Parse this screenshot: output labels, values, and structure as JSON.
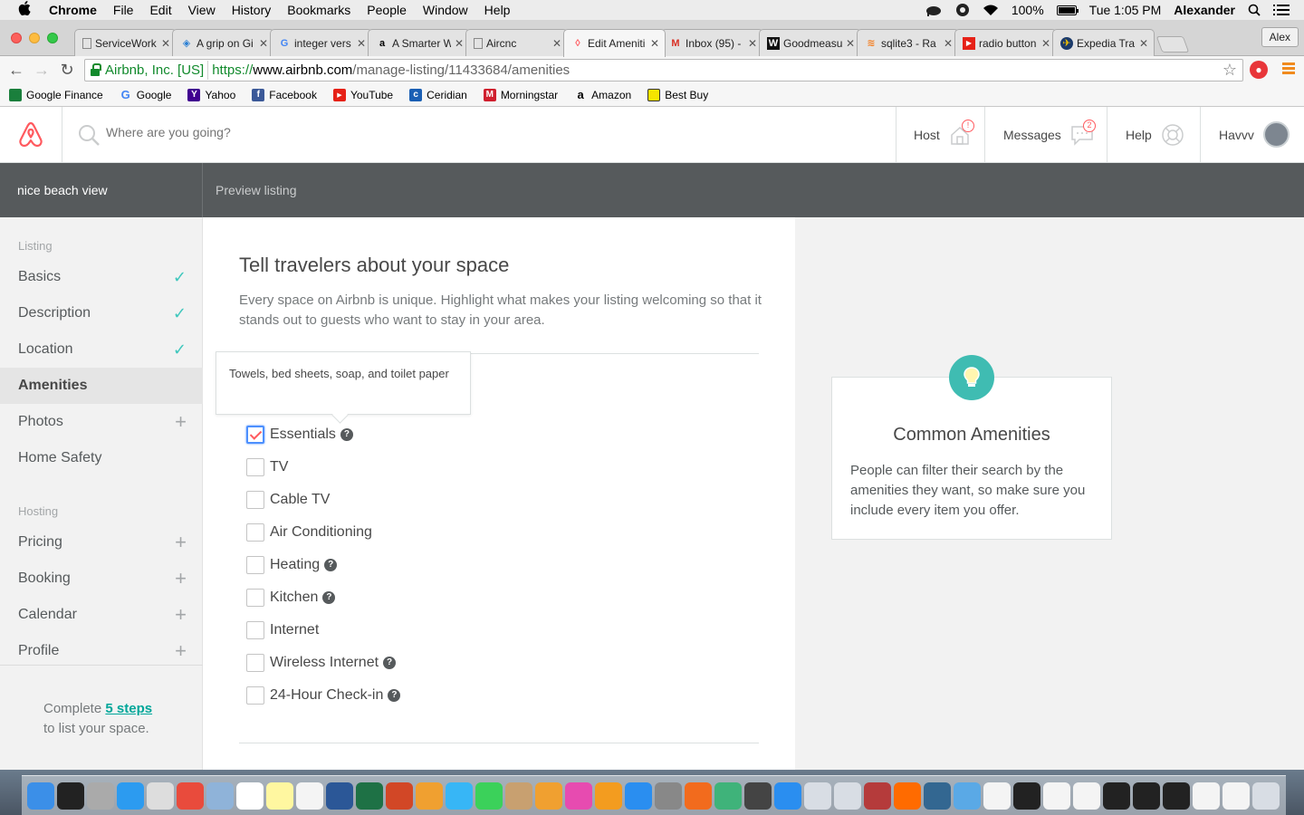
{
  "menubar": {
    "app": "Chrome",
    "items": [
      "File",
      "Edit",
      "View",
      "History",
      "Bookmarks",
      "People",
      "Window",
      "Help"
    ],
    "battery": "100%",
    "clock": "Tue 1:05 PM",
    "user": "Alexander"
  },
  "tabs": [
    {
      "title": "ServiceWork",
      "icon": "document-icon"
    },
    {
      "title": "A grip on Gi",
      "icon": "diamond-icon"
    },
    {
      "title": "integer vers",
      "icon": "google-icon"
    },
    {
      "title": "A Smarter W",
      "icon": "amazon-icon"
    },
    {
      "title": "Aircnc",
      "icon": "document-icon"
    },
    {
      "title": "Edit Ameniti",
      "icon": "airbnb-icon"
    },
    {
      "title": "Inbox (95) -",
      "icon": "gmail-icon"
    },
    {
      "title": "Goodmeasu",
      "icon": "w-icon"
    },
    {
      "title": "sqlite3 - Ra",
      "icon": "stack-icon"
    },
    {
      "title": "radio button",
      "icon": "youtube-icon"
    },
    {
      "title": "Expedia Tra",
      "icon": "globe-icon"
    }
  ],
  "profile_badge": "Alex",
  "address": {
    "ev_label": "Airbnb, Inc. [US]",
    "scheme": "https://",
    "host": "www.airbnb.com",
    "path": "/manage-listing/11433684/amenities"
  },
  "bookmarks": [
    {
      "label": "Google Finance",
      "color": "#1a7f3c"
    },
    {
      "label": "Google",
      "color": "#4285f4"
    },
    {
      "label": "Yahoo",
      "color": "#400090"
    },
    {
      "label": "Facebook",
      "color": "#3b5998"
    },
    {
      "label": "YouTube",
      "color": "#e62117"
    },
    {
      "label": "Ceridian",
      "color": "#1a5fb4"
    },
    {
      "label": "Morningstar",
      "color": "#d01f2e"
    },
    {
      "label": "Amazon",
      "color": "#222222"
    },
    {
      "label": "Best Buy",
      "color": "#f5e400"
    }
  ],
  "header": {
    "search_placeholder": "Where are you going?",
    "host_label": "Host",
    "host_badge": "!",
    "messages_label": "Messages",
    "messages_badge": "2",
    "help_label": "Help",
    "user_name": "Havvv"
  },
  "subnav": {
    "listing_name": "nice beach view",
    "preview": "Preview listing"
  },
  "sidebar": {
    "listing_section": "Listing",
    "listing_items": [
      {
        "label": "Basics",
        "state": "done"
      },
      {
        "label": "Description",
        "state": "done"
      },
      {
        "label": "Location",
        "state": "done"
      },
      {
        "label": "Amenities",
        "state": "active"
      },
      {
        "label": "Photos",
        "state": "add"
      },
      {
        "label": "Home Safety",
        "state": "none"
      }
    ],
    "hosting_section": "Hosting",
    "hosting_items": [
      {
        "label": "Pricing",
        "state": "add"
      },
      {
        "label": "Booking",
        "state": "add"
      },
      {
        "label": "Calendar",
        "state": "add"
      },
      {
        "label": "Profile",
        "state": "add"
      }
    ],
    "complete_prefix": "Complete ",
    "complete_link": "5 steps",
    "complete_suffix": "to list your space."
  },
  "main": {
    "title": "Tell travelers about your space",
    "subtitle": "Every space on Airbnb is unique. Highlight what makes your listing welcoming so that it stands out to guests who want to stay in your area.",
    "tooltip": "Towels, bed sheets, soap, and toilet paper",
    "amenities": [
      {
        "label": "Essentials",
        "checked": true,
        "help": true
      },
      {
        "label": "TV",
        "checked": false,
        "help": false
      },
      {
        "label": "Cable TV",
        "checked": false,
        "help": false
      },
      {
        "label": "Air Conditioning",
        "checked": false,
        "help": false
      },
      {
        "label": "Heating",
        "checked": false,
        "help": true
      },
      {
        "label": "Kitchen",
        "checked": false,
        "help": true
      },
      {
        "label": "Internet",
        "checked": false,
        "help": false
      },
      {
        "label": "Wireless Internet",
        "checked": false,
        "help": true
      },
      {
        "label": "24-Hour Check-in",
        "checked": false,
        "help": true
      }
    ]
  },
  "tip": {
    "title": "Common Amenities",
    "body": "People can filter their search by the amenities they want, so make sure you include every item you offer."
  },
  "colors": {
    "brand": "#ff5a5f",
    "teal": "#00a699",
    "check": "#3fc7bd"
  },
  "dock_apps": [
    "finder",
    "terminal",
    "launchpad",
    "safari",
    "grid",
    "chrome",
    "preview",
    "calendar",
    "notes",
    "textedit",
    "word",
    "excel",
    "powerpoint",
    "photos",
    "messages",
    "facetime",
    "contacts",
    "photos",
    "itunes",
    "ibooks",
    "app-store",
    "system-preferences",
    "zwift",
    "atom",
    "sublime",
    "xcode",
    "help",
    "help",
    "dictionary",
    "sublime-s",
    "postgres",
    "folder",
    "doc",
    "terminal",
    "doc",
    "doc",
    "terminal",
    "terminal",
    "terminal",
    "doc",
    "doc",
    "trash"
  ]
}
